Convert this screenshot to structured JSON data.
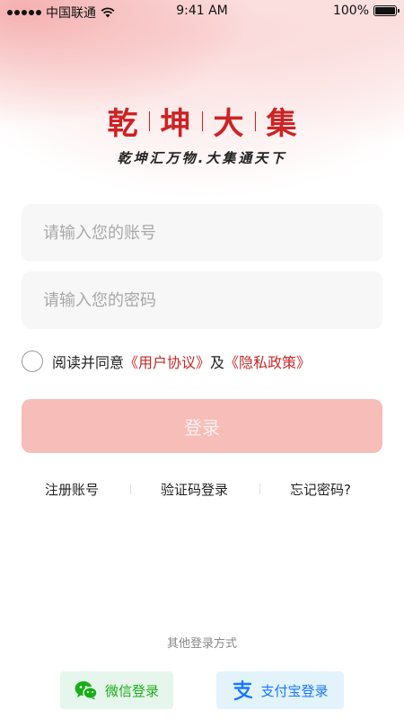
{
  "status_bar": {
    "carrier": "中国联通",
    "time": "9:41 AM",
    "battery": "100%"
  },
  "logo": {
    "chars": [
      "乾",
      "坤",
      "大",
      "集"
    ],
    "slogan": "乾坤汇万物.大集通天下"
  },
  "form": {
    "account_placeholder": "请输入您的账号",
    "password_placeholder": "请输入您的密码",
    "agree_prefix": "阅读并同意",
    "user_agreement": "《用户协议》",
    "and": "及",
    "privacy_policy": "《隐私政策》",
    "login_button": "登录"
  },
  "links": {
    "register": "注册账号",
    "sms_login": "验证码登录",
    "forgot_password": "忘记密码?"
  },
  "other_login": {
    "title": "其他登录方式",
    "wechat": "微信登录",
    "alipay": "支付宝登录"
  },
  "colors": {
    "brand_red": "#cc2323",
    "login_button": "#f6bdb9",
    "wechat_green": "#1aad19",
    "alipay_blue": "#1677ff"
  },
  "icons": [
    "signal-icon",
    "wifi-icon",
    "battery-icon",
    "wechat-icon",
    "alipay-icon"
  ]
}
